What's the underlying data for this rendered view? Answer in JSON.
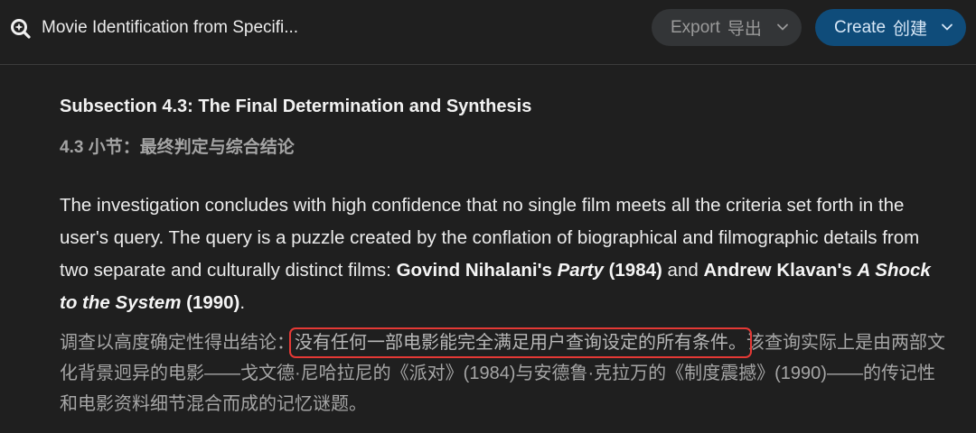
{
  "header": {
    "title": "Movie Identification from Specifi...",
    "export_label": "Export",
    "export_cn": "导出",
    "create_label": "Create",
    "create_cn": "创建",
    "icons": [
      "search-spark-icon",
      "chevron-down-icon"
    ]
  },
  "section": {
    "heading_en": "Subsection 4.3: The Final Determination and Synthesis",
    "heading_cn": "4.3 小节：最终判定与综合结论",
    "para_en": {
      "t1": "The investigation concludes with high confidence that no single film meets all the criteria set forth in the user's query. The query is a puzzle created by the conflation of biographical and filmographic details from two separate and culturally distinct films: ",
      "b1a": "Govind Nihalani's ",
      "b1i": "Party",
      "b1b": " (1984)",
      "t2": " and ",
      "b2a": "Andrew Klavan's ",
      "b2i": "A Shock to the System",
      "b2b": " (1990)",
      "t3": "."
    },
    "para_cn": {
      "prefix": "调查以高度确定性得出结论：",
      "highlight": "没有任何一部电影能完全满足用户查询设定的所有条件。",
      "suffix": "该查询实际上是由两部文化背景迥异的电影——戈文德·尼哈拉尼的《派对》(1984)与安德鲁·克拉万的《制度震撼》(1990)——的传记性和电影资料细节混合而成的记忆谜题。"
    },
    "highlight_color": "#e53935"
  }
}
